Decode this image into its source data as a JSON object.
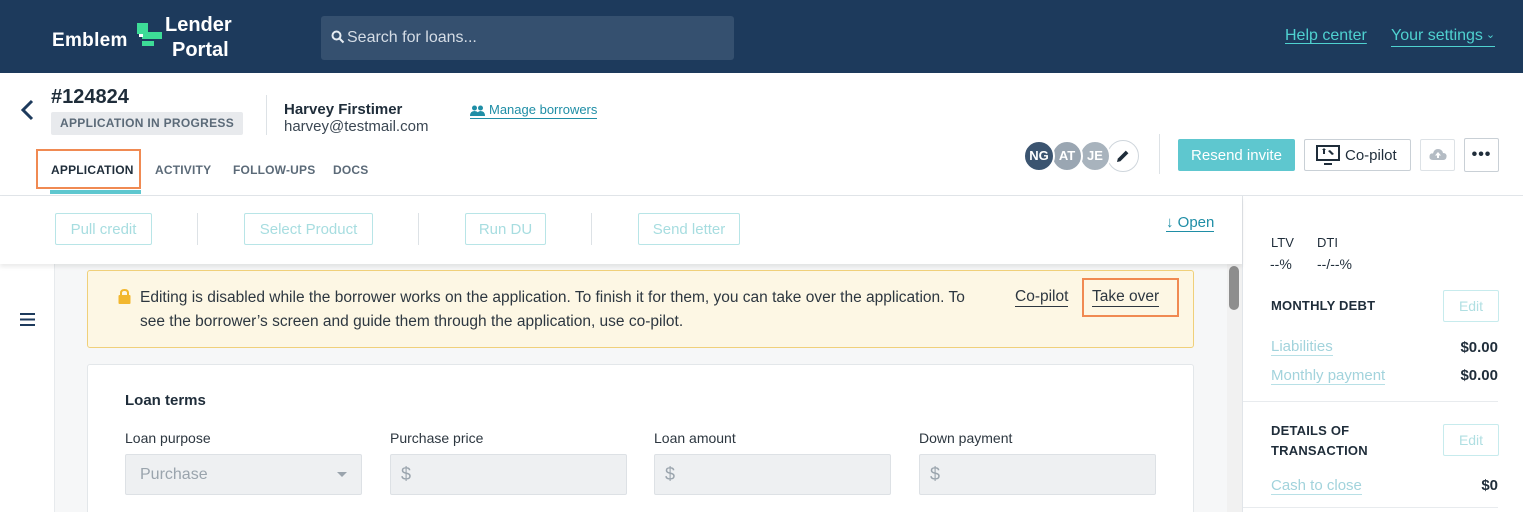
{
  "brand": {
    "emblem": "Emblem",
    "lender": "Lender",
    "portal": "Portal"
  },
  "search": {
    "placeholder": "Search for loans..."
  },
  "topnav": {
    "help": "Help center",
    "settings": "Your settings"
  },
  "loan": {
    "id": "#124824",
    "status": "APPLICATION IN PROGRESS",
    "borrower_name": "Harvey Firstimer",
    "borrower_email": "harvey@testmail.com",
    "manage_label": "Manage borrowers"
  },
  "tabs": [
    {
      "label": "APPLICATION",
      "active": true
    },
    {
      "label": "ACTIVITY"
    },
    {
      "label": "FOLLOW-UPS"
    },
    {
      "label": "DOCS"
    }
  ],
  "team": {
    "avatars": [
      "NG",
      "AT",
      "JE"
    ]
  },
  "header_actions": {
    "resend": "Resend invite",
    "copilot": "Co-pilot"
  },
  "actions": {
    "pull_credit": "Pull credit",
    "select_product": "Select Product",
    "run_du": "Run DU",
    "send_letter": "Send letter",
    "open": "Open"
  },
  "alert": {
    "text": "Editing is disabled while the borrower works on the application. To finish it for them, you can take over the application. To see the borrower’s screen and guide them through the application, use co-pilot.",
    "copilot": "Co-pilot",
    "takeover": "Take over"
  },
  "loan_terms": {
    "title": "Loan terms",
    "fields": [
      {
        "label": "Loan purpose",
        "value": "Purchase"
      },
      {
        "label": "Purchase price",
        "value": "$"
      },
      {
        "label": "Loan amount",
        "value": "$"
      },
      {
        "label": "Down payment",
        "value": "$"
      }
    ]
  },
  "summary": {
    "ltv_label": "LTV",
    "ltv_value": "--%",
    "dti_label": "DTI",
    "dti_value": "--/--%",
    "monthly_debt": "MONTHLY DEBT",
    "details": "DETAILS OF TRANSACTION",
    "edit": "Edit",
    "rows": [
      {
        "label": "Liabilities",
        "value": "$0.00"
      },
      {
        "label": "Monthly payment",
        "value": "$0.00"
      },
      {
        "label": "Cash to close",
        "value": "$0"
      }
    ]
  },
  "colors": {
    "navy": "#1d3a5c",
    "teal": "#5ec7cf",
    "link": "#4fd1d0",
    "highlight": "#f08a52",
    "alert_bg": "#fdf7e4"
  }
}
